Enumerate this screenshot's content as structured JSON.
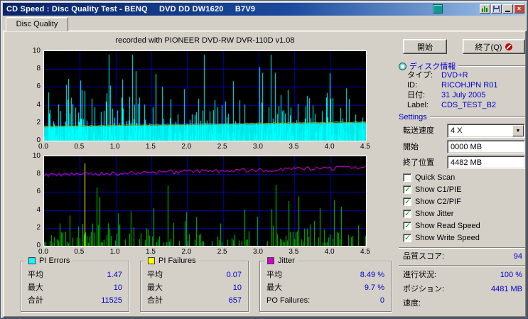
{
  "window": {
    "title": "CD Speed : Disc Quality Test - BENQ     DVD DD DW1620     B7V9"
  },
  "tab": {
    "label": "Disc Quality"
  },
  "note": "recorded with PIONEER DVD-RW  DVR-110D v1.08",
  "colors": {
    "pi_errors": "#00ffff",
    "pi_failures": "#ffff00",
    "jitter": "#cc00cc",
    "write_speed_line": "#b4b400",
    "value_text": "#0000cc",
    "chart_grid": "#0000b4",
    "titlebar": "#0a246a"
  },
  "stats": {
    "pi_errors": {
      "title": "PI Errors",
      "color": "#00ffff",
      "rows": [
        {
          "label": "平均",
          "value": "1.47"
        },
        {
          "label": "最大",
          "value": "10"
        },
        {
          "label": "合計",
          "value": "11525"
        }
      ]
    },
    "pi_failures": {
      "title": "PI Failures",
      "color": "#ffff00",
      "rows": [
        {
          "label": "平均",
          "value": "0.07"
        },
        {
          "label": "最大",
          "value": "10"
        },
        {
          "label": "合計",
          "value": "657"
        }
      ]
    },
    "jitter": {
      "title": "Jitter",
      "color": "#cc00cc",
      "rows": [
        {
          "label": "平均",
          "value": "8.49 %"
        },
        {
          "label": "最大",
          "value": "9.7 %"
        },
        {
          "label": "PO Failures:",
          "value": "0"
        }
      ]
    }
  },
  "side": {
    "start_button": "開始",
    "exit_button": "終了(Q)",
    "disc_info": {
      "title": "ディスク情報",
      "rows": [
        {
          "label": "タイプ:",
          "value": "DVD+R"
        },
        {
          "label": "ID:",
          "value": "RICOHJPN R01"
        },
        {
          "label": "日付:",
          "value": "31 July 2005"
        },
        {
          "label": "Label:",
          "value": "CDS_TEST_B2"
        }
      ]
    },
    "settings": {
      "title": "Settings",
      "speed_label": "転送速度",
      "speed_value": "4 X",
      "start_label": "開始",
      "start_value": "0000 MB",
      "end_label": "終了位置",
      "end_value": "4482 MB",
      "checkboxes": [
        {
          "label": "Quick Scan",
          "checked": false
        },
        {
          "label": "Show C1/PIE",
          "checked": true
        },
        {
          "label": "Show C2/PIF",
          "checked": true
        },
        {
          "label": "Show Jitter",
          "checked": true
        },
        {
          "label": "Show Read Speed",
          "checked": true
        },
        {
          "label": "Show Write Speed",
          "checked": true
        }
      ]
    },
    "score": {
      "label": "品質スコア:",
      "value": "94"
    },
    "progress": [
      {
        "label": "進行状況:",
        "value": "100 %"
      },
      {
        "label": "ポジション:",
        "value": "4481 MB"
      },
      {
        "label": "速度:",
        "value": ""
      }
    ]
  },
  "chart_data": [
    {
      "id": "pie_chart",
      "type": "bar",
      "title": "PI Errors (cyan spikes) with write speed line",
      "x_ticks": [
        "0.0",
        "0.5",
        "1.0",
        "1.5",
        "2.0",
        "2.5",
        "3.0",
        "3.5",
        "4.0",
        "4.5"
      ],
      "y_ticks": [
        10,
        8,
        6,
        4,
        2,
        0
      ],
      "xlim": [
        0,
        4.5
      ],
      "ylim": [
        0,
        10
      ],
      "grid_color": "#0000b4",
      "series": [
        {
          "name": "write_speed_area",
          "kind": "area",
          "color": "#00e6e6",
          "start": 1.55,
          "end": 2.05
        },
        {
          "name": "pi_errors_spikes",
          "kind": "spikes",
          "color": "#00ffff",
          "seed": 12,
          "step": 1,
          "density": 0.55,
          "min": 0.4,
          "scale": 1.9,
          "max": 9.6,
          "boost": 0.05
        },
        {
          "name": "write_speed_line",
          "kind": "line",
          "color": "#b4b400",
          "start": 1.6,
          "end": 2.1,
          "noise": 0.06,
          "seed": 5
        }
      ],
      "summary": {
        "pi_errors_avg": 1.47,
        "pi_errors_max": 10,
        "pi_errors_total": 11525
      }
    },
    {
      "id": "pif_chart",
      "type": "bar",
      "title": "PI Failures (green spikes) with jitter line (magenta)",
      "x_ticks": [
        "0.0",
        "0.5",
        "1.0",
        "1.5",
        "2.0",
        "2.5",
        "3.0",
        "3.5",
        "4.0",
        "4.5"
      ],
      "y_ticks": [
        10,
        8,
        6,
        4,
        2,
        0
      ],
      "xlim": [
        0,
        4.5
      ],
      "ylim": [
        0,
        10
      ],
      "grid_color": "#0000b4",
      "series": [
        {
          "name": "pi_failures_spikes",
          "kind": "spikes",
          "color": "#00cc00",
          "seed": 77,
          "step": 2,
          "density": 0.6,
          "min": 0.3,
          "scale": 1.3,
          "max": 6.8,
          "boost": 0.03
        },
        {
          "name": "pif_peak",
          "kind": "vline",
          "color": "#ffff00",
          "at": 0.126,
          "height": 9.2
        },
        {
          "name": "jitter_line",
          "kind": "line",
          "color": "#ff00ff",
          "start": 7.9,
          "end": 8.75,
          "noise": 0.24,
          "seed": 9
        }
      ],
      "summary": {
        "jitter_avg_pct": 8.49,
        "jitter_max_pct": 9.7,
        "pi_failures_avg": 0.07,
        "pi_failures_max": 10,
        "pi_failures_total": 657,
        "po_failures": 0
      }
    }
  ]
}
